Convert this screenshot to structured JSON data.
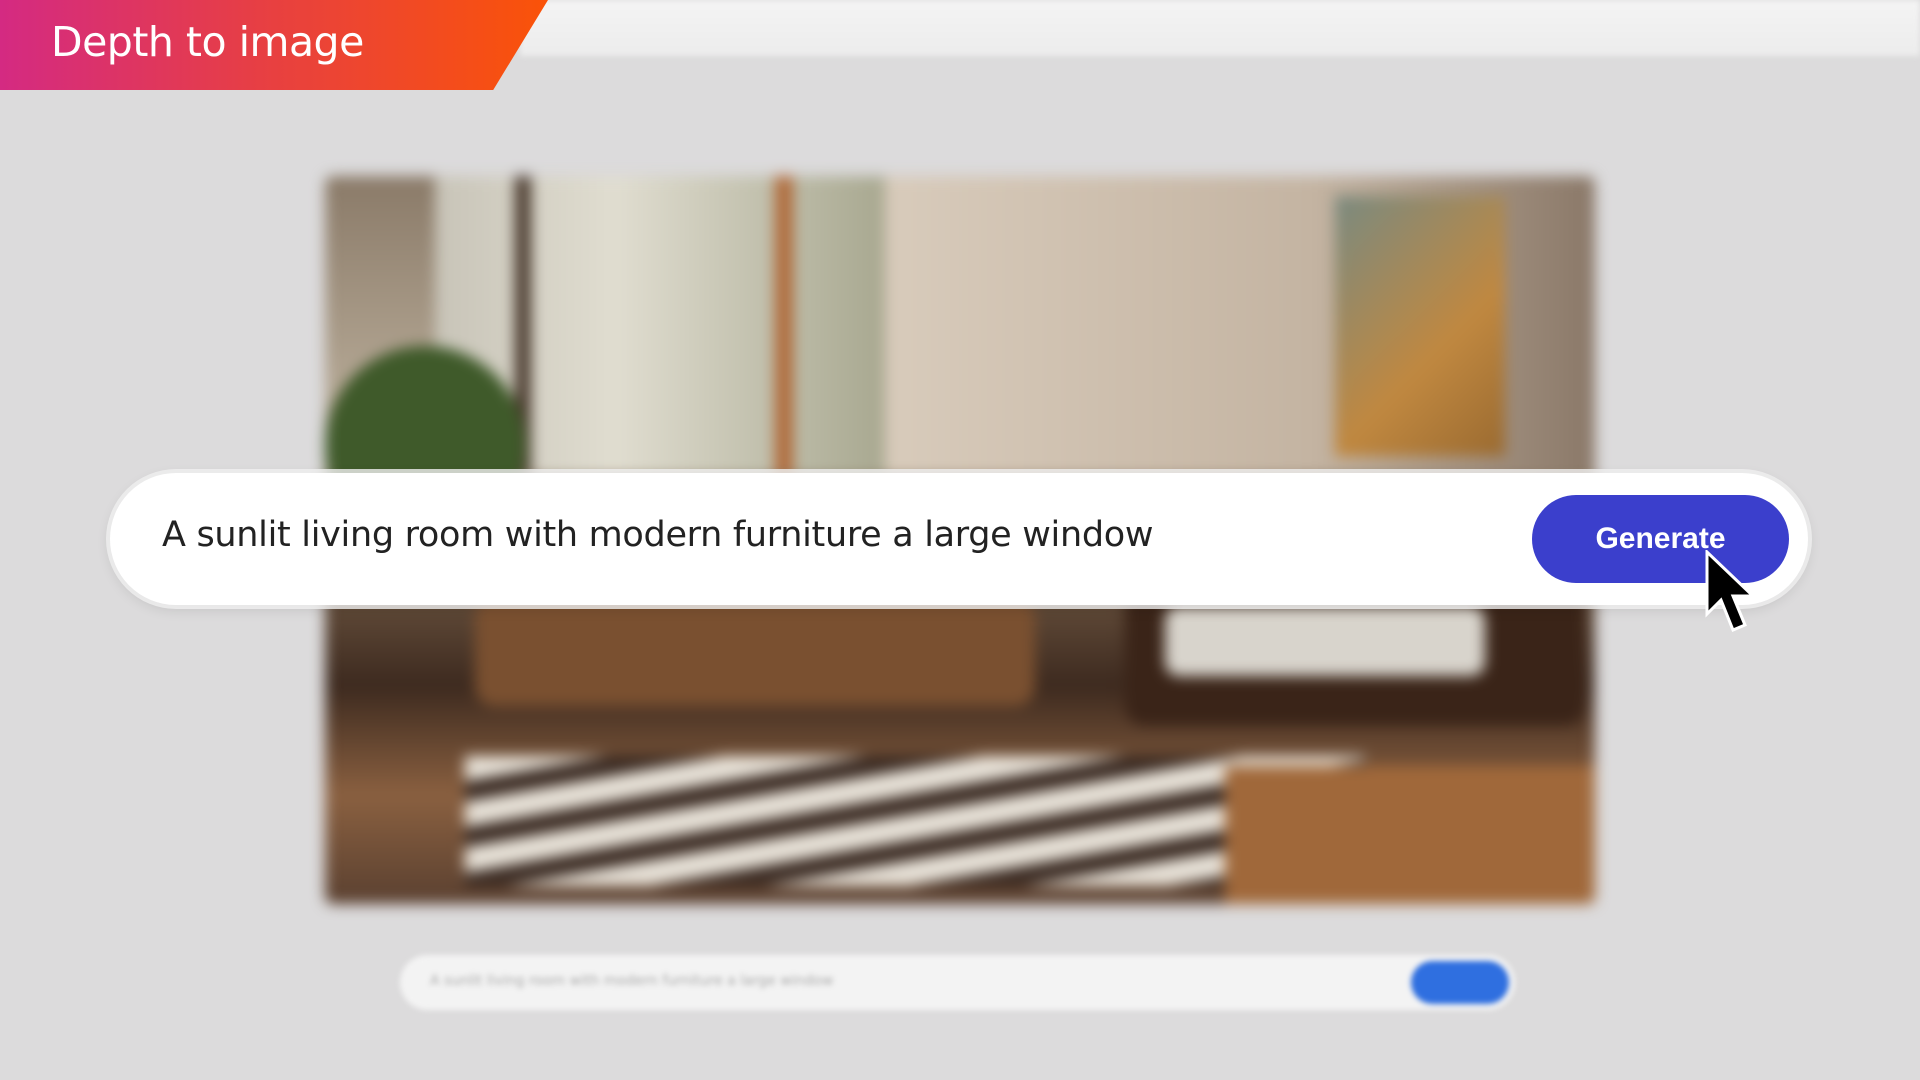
{
  "banner": {
    "title": "Depth to image"
  },
  "prompt": {
    "value": "A sunlit living room with modern furniture a large window",
    "button_label": "Generate"
  },
  "background_bar": {
    "value": "A sunlit living room with modern furniture a large window"
  },
  "colors": {
    "accent": "#3b3fcc",
    "banner_start": "#d42a82",
    "banner_end": "#fa5308"
  },
  "icons": {
    "cursor": "arrow-cursor-icon"
  }
}
